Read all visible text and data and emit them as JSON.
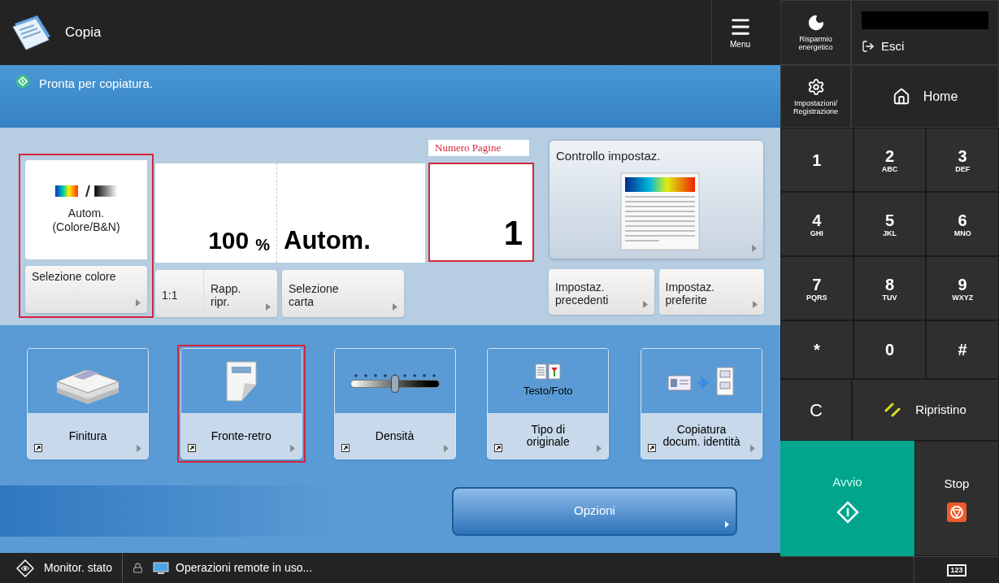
{
  "header": {
    "title": "Copia",
    "menu_label": "Menu"
  },
  "status": {
    "message": "Pronta per copiatura."
  },
  "settings": {
    "color": {
      "value": "Autom.\n(Colore/B&N)",
      "button": "Selezione colore",
      "highlighted": true
    },
    "ratio": {
      "value": "100",
      "unit": "%",
      "buttons": [
        "1:1",
        "Rapp.\nripr."
      ]
    },
    "paper": {
      "value": "Autom.",
      "button": "Selezione\ncarta"
    },
    "copies": {
      "annotation": "Numero Pagine",
      "value": "1",
      "highlighted": true
    },
    "check": {
      "label": "Controllo impostaz."
    },
    "presets": [
      "Impostaz.\nprecedenti",
      "Impostaz.\npreferite"
    ]
  },
  "functions": [
    {
      "kind": "finishing",
      "label": "Finitura",
      "highlighted": false
    },
    {
      "kind": "duplex",
      "label": "Fronte-retro",
      "highlighted": true
    },
    {
      "kind": "density",
      "label": "Densità",
      "level": 0.5,
      "highlighted": false
    },
    {
      "kind": "original_type",
      "caption": "Testo/Foto",
      "label": "Tipo di\noriginale",
      "highlighted": false
    },
    {
      "kind": "id_copy",
      "label": "Copiatura\ndocum. identità",
      "highlighted": false
    }
  ],
  "options_button": "Opzioni",
  "footer": {
    "monitor": "Monitor. stato",
    "remote": "Operazioni remote in uso..."
  },
  "side": {
    "energy": "Risparmio\nenergetico",
    "logout": "Esci",
    "settings": "Impostazioni/\nRegistrazione",
    "home": "Home",
    "keys": [
      {
        "main": "1"
      },
      {
        "main": "2",
        "sub": "ABC"
      },
      {
        "main": "3",
        "sub": "DEF"
      },
      {
        "main": "4",
        "sub": "GHI"
      },
      {
        "main": "5",
        "sub": "JKL"
      },
      {
        "main": "6",
        "sub": "MNO"
      },
      {
        "main": "7",
        "sub": "PQRS"
      },
      {
        "main": "8",
        "sub": "TUV"
      },
      {
        "main": "9",
        "sub": "WXYZ"
      },
      {
        "main": "*"
      },
      {
        "main": "0"
      },
      {
        "main": "#"
      }
    ],
    "clear": "C",
    "reset": "Ripristino",
    "start": "Avvio",
    "stop": "Stop",
    "keypad_label": "123"
  }
}
